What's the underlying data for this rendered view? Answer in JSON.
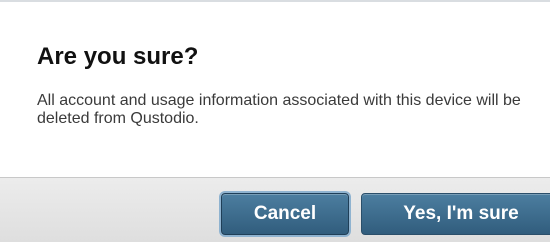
{
  "dialog": {
    "title": "Are you sure?",
    "message": "All account and usage information associated with this device will be deleted from Qustodio."
  },
  "buttons": {
    "cancel_label": "Cancel",
    "confirm_label": "Yes, I'm sure"
  },
  "colors": {
    "button_primary": "#3a6a8c",
    "footer_background": "#e4e4e4",
    "title_text": "#111111"
  }
}
